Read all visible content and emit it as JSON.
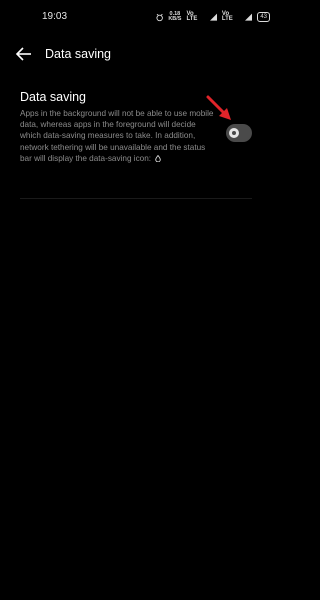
{
  "status_bar": {
    "time": "19:03",
    "speed_value": "0.18",
    "speed_unit": "KB/S",
    "net1": "Vo LTE",
    "net2": "Vo LTE",
    "battery": "43"
  },
  "header": {
    "title": "Data saving",
    "back_icon": "back-arrow-icon"
  },
  "setting": {
    "title": "Data saving",
    "description": "Apps in the background will not be able to use mobile data, whereas apps in the foreground will decide which data-saving measures to take. In addition, network tethering will be unavailable and the status bar will display the data-saving icon:",
    "toggle_state": "off"
  },
  "annotation": {
    "arrow_color": "#e0242a"
  }
}
